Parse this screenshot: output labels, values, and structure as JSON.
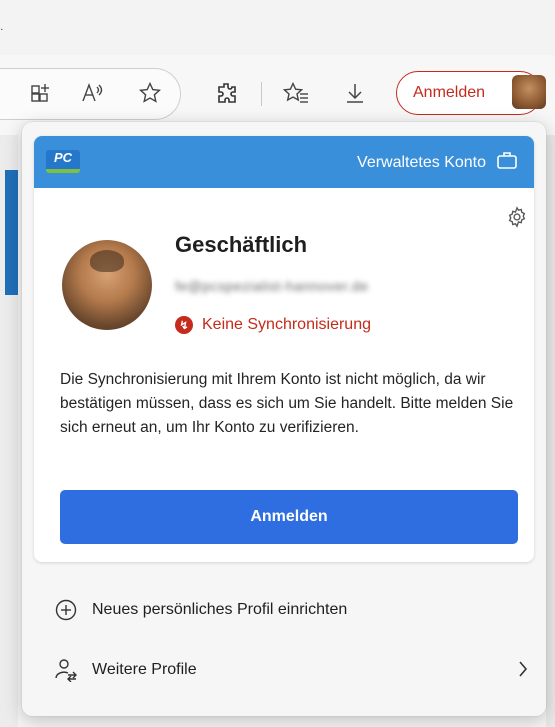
{
  "toolbar": {
    "signin_label": "Anmelden",
    "icons": [
      "app-available-icon",
      "read-aloud-icon",
      "favorite-star-icon",
      "extensions-icon",
      "favorites-icon",
      "downloads-icon"
    ]
  },
  "popup": {
    "header": {
      "account_type": "Verwaltetes Konto"
    },
    "profile": {
      "name": "Geschäftlich",
      "email": "fe@pcspezialist-hannover.de",
      "sync_status": "Keine Synchronisierung"
    },
    "message": "Die Synchronisierung mit Ihrem Konto ist nicht möglich, da wir bestätigen müssen, dass es sich um Sie handelt. Bitte melden Sie sich erneut an, um Ihr Konto zu verifizieren.",
    "signin_button": "Anmelden",
    "menu": {
      "new_profile": "Neues persönliches Profil einrichten",
      "more_profiles": "Weitere Profile"
    }
  },
  "colors": {
    "accent_blue": "#2f6ee0",
    "header_blue": "#3a8fdb",
    "error_red": "#c42b1c"
  }
}
